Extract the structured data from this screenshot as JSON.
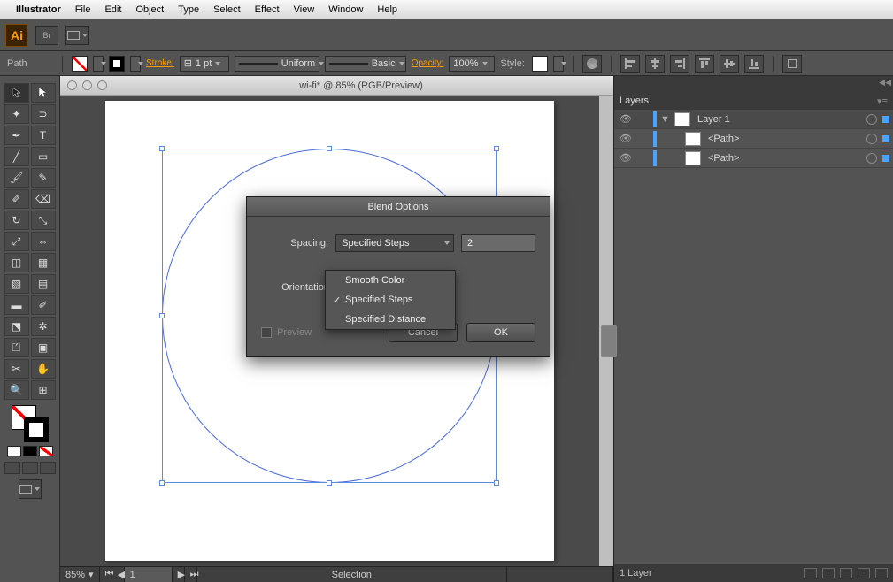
{
  "menubar": {
    "app": "Illustrator",
    "items": [
      "File",
      "Edit",
      "Object",
      "Type",
      "Select",
      "Effect",
      "View",
      "Window",
      "Help"
    ]
  },
  "controlbar": {
    "path_label": "Path",
    "stroke_label": "Stroke:",
    "stroke_weight": "1 pt",
    "profile": "Uniform",
    "brush": "Basic",
    "opacity_label": "Opacity:",
    "opacity": "100%",
    "style_label": "Style:"
  },
  "document": {
    "title": "wi-fi* @ 85% (RGB/Preview)"
  },
  "statusbar": {
    "zoom": "85%",
    "page": "1",
    "mode": "Selection"
  },
  "dialog": {
    "title": "Blend Options",
    "spacing_label": "Spacing:",
    "spacing_value": "Specified Steps",
    "spacing_input": "2",
    "orientation_label": "Orientation:",
    "options": [
      "Smooth Color",
      "Specified Steps",
      "Specified Distance"
    ],
    "selected_option": "Specified Steps",
    "preview_label": "Preview",
    "cancel": "Cancel",
    "ok": "OK"
  },
  "layers": {
    "panel_title": "Layers",
    "rows": [
      {
        "name": "Layer 1",
        "indent": 0,
        "expand": true
      },
      {
        "name": "<Path>",
        "indent": 1,
        "expand": false
      },
      {
        "name": "<Path>",
        "indent": 1,
        "expand": false
      }
    ],
    "footer": "1 Layer"
  }
}
